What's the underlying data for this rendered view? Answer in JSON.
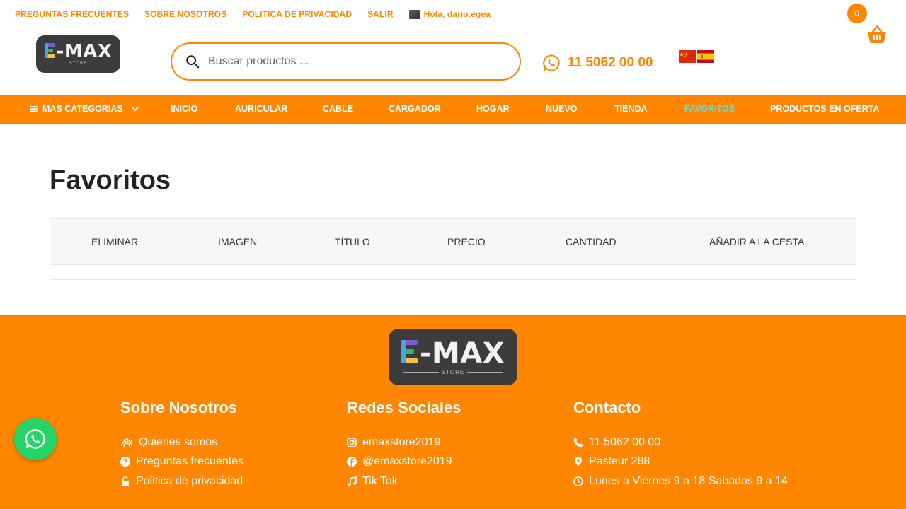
{
  "topbar": {
    "links": [
      "PREGUNTAS FRECUENTES",
      "SOBRE NOSOTROS",
      "POLITICA DE PRIVACIDAD",
      "SALIR"
    ],
    "greeting": "Hola, dario.egea",
    "cart_count": "0"
  },
  "logo": {
    "main": "-MAX",
    "sub": "STORE"
  },
  "search": {
    "placeholder": "Buscar productos ..."
  },
  "phone": "11 5062 00 00",
  "nav": {
    "categories": "MAS CATEGORIAS",
    "items": [
      "INICIO",
      "AURICULAR",
      "CABLE",
      "CARGADOR",
      "HOGAR",
      "NUEVO",
      "TIENDA",
      "FAVORITOS",
      "PRODUCTOS EN OFERTA"
    ],
    "active": "FAVORITOS"
  },
  "page": {
    "title": "Favoritos",
    "columns": [
      "ELIMINAR",
      "IMAGEN",
      "TÍTULO",
      "PRECIO",
      "CANTIDAD",
      "AÑADIR A LA CESTA"
    ]
  },
  "footer": {
    "col1": {
      "title": "Sobre Nosotros",
      "items": [
        "Quienes somos",
        "Preguntas frecuentes",
        "Politica de privacidad"
      ]
    },
    "col2": {
      "title": "Redes Sociales",
      "items": [
        "emaxstore2019",
        "@emaxstore2019",
        "Tik Tok"
      ]
    },
    "col3": {
      "title": "Contacto",
      "items": [
        "11 5062 00 00",
        "Pasteur 288",
        "Lunes a Viernes 9 a 18 Sabados 9 a 14"
      ]
    }
  },
  "colors": {
    "accent": "#ff8600",
    "active_nav": "#5fe0e6",
    "whatsapp": "#25d366",
    "logo_bg": "#3c3c3c"
  },
  "icons": [
    "search-icon",
    "whatsapp-icon",
    "cart-icon",
    "china-flag-icon",
    "spain-flag-icon",
    "menu-icon",
    "chevron-down-icon",
    "people-icon",
    "question-icon",
    "lock-icon",
    "instagram-icon",
    "facebook-icon",
    "music-icon",
    "phone-icon",
    "location-icon",
    "clock-icon"
  ]
}
